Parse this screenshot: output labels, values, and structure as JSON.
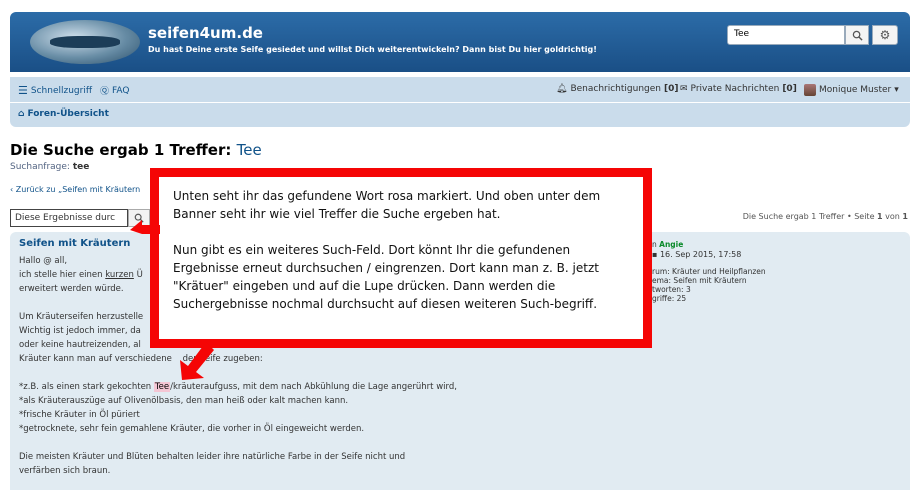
{
  "header": {
    "site_title": "seifen4um.de",
    "site_description": "Du hast Deine erste Seife gesiedet und willst Dich weiterentwickeln? Dann bist Du hier goldrichtig!",
    "search_value": "Tee"
  },
  "nav": {
    "quick_access": "Schnellzugriff",
    "faq": "FAQ",
    "notifications_label": "Benachrichtigungen",
    "notifications_count": "[0]",
    "messages_label": "Private Nachrichten",
    "messages_count": "[0]",
    "user_name": "Monique Muster",
    "breadcrumb": "Foren-Übersicht"
  },
  "results": {
    "heading": "Die Suche ergab 1 Treffer:",
    "heading_term": "Tee",
    "query_label": "Suchanfrage:",
    "query_value": "tee",
    "back_link": "Zurück zu „Seifen mit Kräutern",
    "filter_value": "Diese Ergebnisse durc",
    "pager_text": "Die Suche ergab 1 Treffer • Seite",
    "pager_current": "1",
    "pager_of": "von",
    "pager_total": "1"
  },
  "post": {
    "title": "Seifen mit Kräutern",
    "line1": "Hallo @ all,",
    "line2a": "ich stelle hier einen ",
    "line2b": "kurzen",
    "line2c": " Ü",
    "line3": "erweitert werden würde.",
    "line4": "Um Kräuterseifen herzustelle",
    "line5": "Wichtig ist jedoch immer, da",
    "line6": "oder keine hautreizenden, al",
    "line7": "Kräuter kann man auf verschiedene    der Seife zugeben:",
    "line8a": "*z.B. als einen stark gekochten ",
    "line8hl": "Tee",
    "line8b": "/kräuteraufguss, mit dem nach Abkühlung die Lage angerührt wird,",
    "line9": "*als Kräuterauszüge auf Olivenölbasis, den man heiß oder kalt machen kann.",
    "line10": "*frische Kräuter in Öl püriert",
    "line11": "*getrocknete, sehr fein gemahlene Kräuter, die vorher in Öl eingeweicht werden.",
    "line12": "Die meisten Kräuter und Blüten behalten leider ihre natürliche Farbe in der Seife nicht und",
    "line13": "verfärben sich braun.",
    "meta_author_prefix": "n",
    "meta_author": "Angie",
    "meta_date": "16. Sep 2015, 17:58",
    "meta_forum": "rum: Kräuter und Heilpflanzen",
    "meta_topic": "ema: Seifen mit Kräutern",
    "meta_replies": "tworten: 3",
    "meta_views": "griffe: 25"
  },
  "annotation": {
    "paragraph1": "Unten seht ihr das gefundene Wort rosa markiert. Und oben unter dem Banner seht ihr wie viel Treffer die Suche ergeben hat.",
    "paragraph2": "Nun gibt es ein weiteres Such-Feld. Dort könnt Ihr die gefundenen Ergebnisse erneut durchsuchen / eingrenzen. Dort kann man z. B. jetzt \"Krätuer\" eingeben und auf die Lupe drücken. Dann werden die Suchergebnisse nochmal durchsucht auf diesen weiteren Such-begriff."
  },
  "colors": {
    "banner": "#1a4f86",
    "nav": "#cadceb",
    "link": "#105289",
    "annotation_border": "#f50505",
    "highlight": "#f4c6d4"
  }
}
